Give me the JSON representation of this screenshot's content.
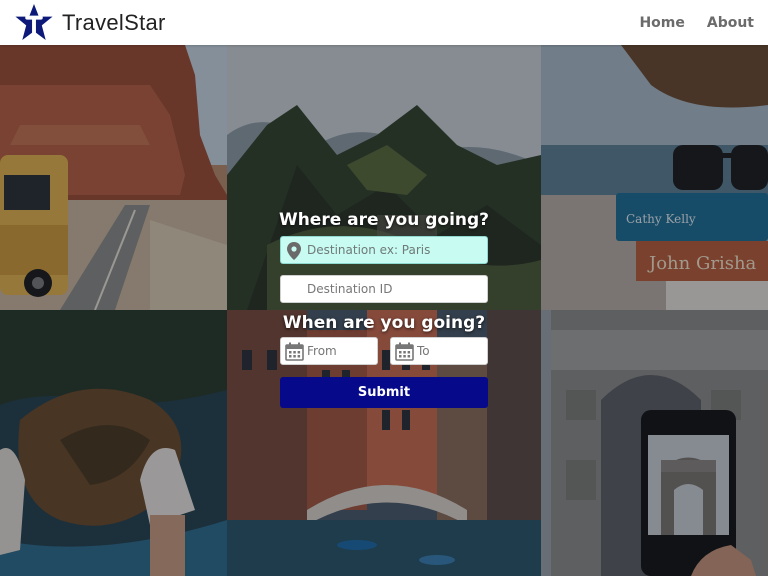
{
  "nav": {
    "brand": "TravelStar",
    "links": [
      "Home",
      "About"
    ]
  },
  "search": {
    "heading_where": "Where are you going?",
    "destination_placeholder": "Destination ex: Paris",
    "destination_id_placeholder": "Destination ID",
    "heading_when": "When are you going?",
    "from_placeholder": "From",
    "to_placeholder": "To",
    "submit_label": "Submit"
  },
  "colors": {
    "brand_star": "#0d1a7a",
    "submit_bg": "#060a8a",
    "destination_bg": "#c8fbf2"
  },
  "icons": {
    "logo": "star-logo-icon",
    "destination": "map-pin-icon",
    "date": "calendar-icon"
  }
}
